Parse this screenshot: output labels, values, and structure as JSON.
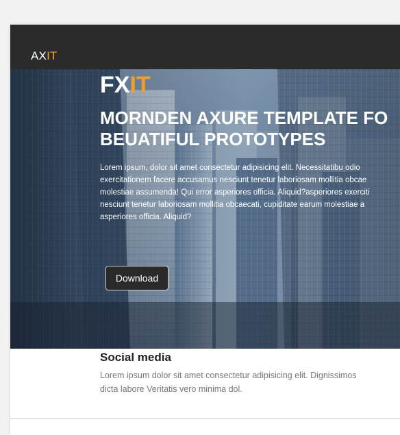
{
  "navbar": {
    "logo_prefix": "AX",
    "logo_suffix": "IT"
  },
  "hero": {
    "brand_prefix": "FX",
    "brand_suffix": "IT",
    "title_line1": "MORNDEN AXURE TEMPLATE FO",
    "title_line2": "BEUATIFUL PROTOTYPES",
    "body_lines": [
      "Lorem ipsum, dolor sit amet consectetur adipisicing elit. Necessitatibu odio",
      "exercitationem facere accusamus nesciunt tenetur laboriosam mollitia obcae",
      "molestiae assumenda! Qui error asperiores officia. Aliquid?asperiores exerciti",
      "nesciunt tenetur laboriosam mollitia obcaecati, cupiditate earum molestiae a",
      "asperiores officia. Aliquid?"
    ],
    "download_label": "Download"
  },
  "social": {
    "title": "Social media",
    "text_line1": "Lorem ipsum dolor sit amet consectetur adipisicing elit. Dignissimos",
    "text_line2": "dicta labore Veritatis vero minima dol."
  },
  "colors": {
    "accent": "#f0a02a",
    "navbar": "#2b2b2b"
  }
}
